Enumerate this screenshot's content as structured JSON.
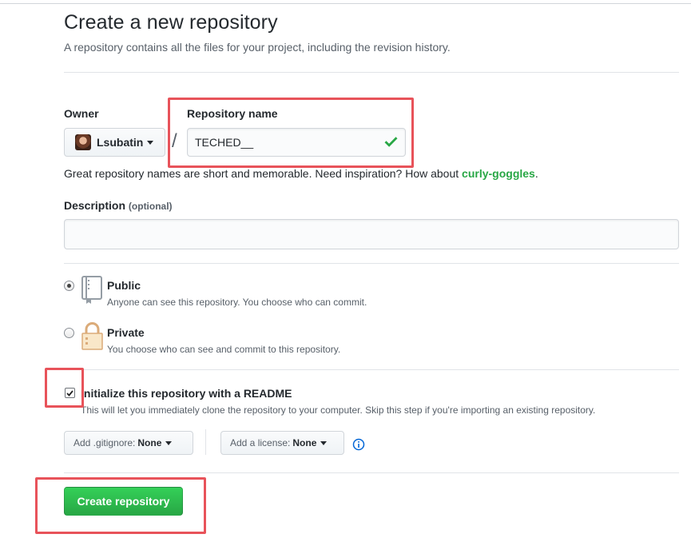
{
  "page": {
    "title": "Create a new repository",
    "subtitle": "A repository contains all the files for your project, including the revision history."
  },
  "owner": {
    "label": "Owner",
    "value": "Lsubatin"
  },
  "repo_name": {
    "label": "Repository name",
    "value": "TECHED__",
    "separator": "/"
  },
  "hint": {
    "text": "Great repository names are short and memorable. Need inspiration? How about ",
    "suggestion": "curly-goggles",
    "end": "."
  },
  "description": {
    "label": "Description",
    "optional": "(optional)",
    "value": ""
  },
  "visibility": {
    "public": {
      "title": "Public",
      "note": "Anyone can see this repository. You choose who can commit.",
      "selected": true
    },
    "private": {
      "title": "Private",
      "note": "You choose who can see and commit to this repository.",
      "selected": false
    }
  },
  "readme": {
    "label": "Initialize this repository with a README",
    "note": "This will let you immediately clone the repository to your computer. Skip this step if you're importing an existing repository.",
    "checked": true
  },
  "gitignore": {
    "prefix": "Add .gitignore:",
    "value": "None"
  },
  "license": {
    "prefix": "Add a license:",
    "value": "None"
  },
  "create_button": {
    "label": "Create repository"
  },
  "colors": {
    "primary_green": "#28a745",
    "highlight_red": "#e8535a",
    "info_blue": "#0366d6"
  },
  "icons": [
    "check-icon",
    "repo-book-icon",
    "lock-icon",
    "info-icon",
    "caret-down-icon"
  ]
}
